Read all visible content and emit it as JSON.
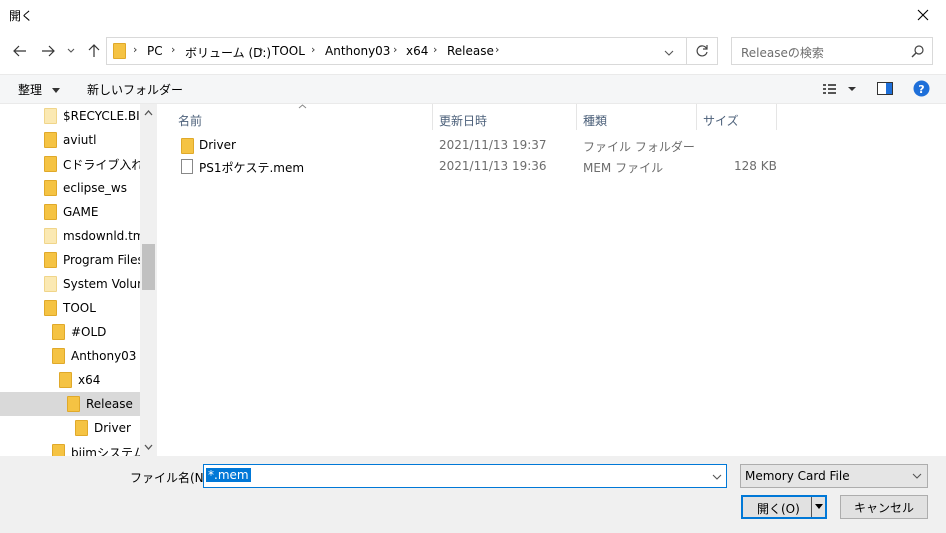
{
  "window": {
    "title": "開く"
  },
  "address": {
    "crumbs": [
      "PC",
      "ボリューム (D:)",
      "TOOL",
      "Anthony03",
      "x64",
      "Release"
    ]
  },
  "search": {
    "placeholder": "Releaseの検索"
  },
  "toolbar": {
    "organize": "整理",
    "new_folder": "新しいフォルダー"
  },
  "tree": [
    {
      "label": "$RECYCLE.BIN",
      "pale": true
    },
    {
      "label": "aviutl",
      "pale": false
    },
    {
      "label": "Cドライブ入れ替え",
      "pale": false
    },
    {
      "label": "eclipse_ws",
      "pale": false
    },
    {
      "label": "GAME",
      "pale": false
    },
    {
      "label": "msdownld.tmp",
      "pale": true
    },
    {
      "label": "Program Files",
      "pale": false
    },
    {
      "label": "System Volume",
      "pale": true
    },
    {
      "label": "TOOL",
      "pale": false
    },
    {
      "label": "#OLD",
      "pale": false
    },
    {
      "label": "Anthony03",
      "pale": false
    },
    {
      "label": "x64",
      "pale": false
    },
    {
      "label": "Release",
      "pale": false,
      "selected": true
    },
    {
      "label": "Driver",
      "pale": false
    },
    {
      "label": "biimシステム",
      "pale": false
    }
  ],
  "columns": {
    "name": "名前",
    "date": "更新日時",
    "type": "種類",
    "size": "サイズ"
  },
  "files": [
    {
      "name": "Driver",
      "date": "2021/11/13 19:37",
      "type": "ファイル フォルダー",
      "size": "",
      "kind": "folder"
    },
    {
      "name": "PS1ポケステ.mem",
      "date": "2021/11/13 19:36",
      "type": "MEM ファイル",
      "size": "128 KB",
      "kind": "file"
    }
  ],
  "bottom": {
    "filename_label": "ファイル名(N):",
    "filename_value": "*.mem",
    "filter_value": "Memory Card File",
    "open_label": "開く(O)",
    "cancel_label": "キャンセル"
  }
}
